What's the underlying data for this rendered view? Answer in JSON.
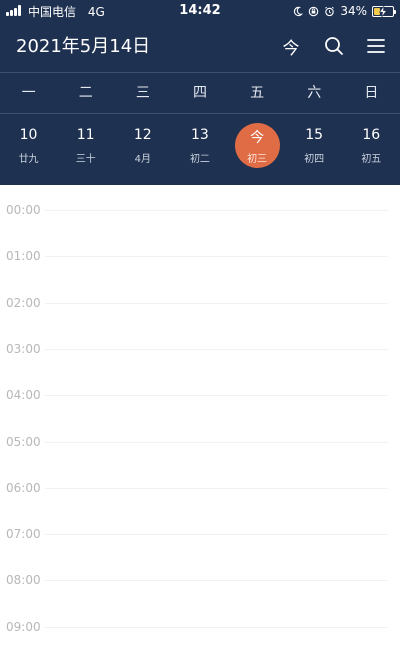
{
  "status_bar": {
    "carrier": "中国电信",
    "network": "4G",
    "time": "14:42",
    "battery_percent": "34%",
    "battery_level": 0.34,
    "battery_color": "#f2c94c"
  },
  "header": {
    "title": "2021年5月14日",
    "today_button": "今",
    "background": "#1f3150"
  },
  "weekdays": [
    "一",
    "二",
    "三",
    "四",
    "五",
    "六",
    "日"
  ],
  "dates": [
    {
      "day": "10",
      "lunar": "廿九"
    },
    {
      "day": "11",
      "lunar": "三十"
    },
    {
      "day": "12",
      "lunar": "4月"
    },
    {
      "day": "13",
      "lunar": "初二"
    },
    {
      "day": "今",
      "lunar": "初三",
      "selected": true
    },
    {
      "day": "15",
      "lunar": "初四"
    },
    {
      "day": "16",
      "lunar": "初五"
    }
  ],
  "accent_color": "#e06c46",
  "hours": [
    "00:00",
    "01:00",
    "02:00",
    "03:00",
    "04:00",
    "05:00",
    "06:00",
    "07:00",
    "08:00",
    "09:00"
  ]
}
